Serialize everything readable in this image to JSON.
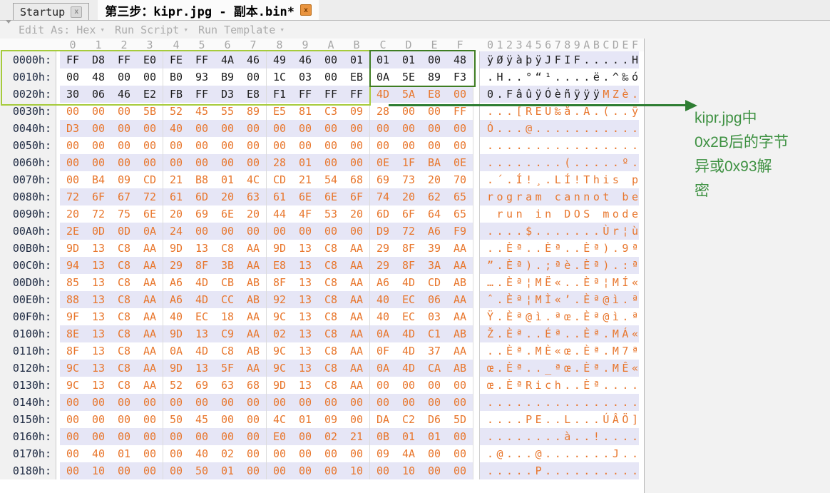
{
  "tabs": {
    "startup": {
      "label": "Startup",
      "close_glyph": "x"
    },
    "active": {
      "label": "第三步：kipr.jpg - 副本.bin*",
      "close_glyph": "x"
    }
  },
  "toolbar": {
    "edit_as": "Edit As: Hex",
    "run_script": "Run Script",
    "run_template": "Run Template",
    "caret": "▾"
  },
  "header": {
    "byte_cols": [
      "0",
      "1",
      "2",
      "3",
      "4",
      "5",
      "6",
      "7",
      "8",
      "9",
      "A",
      "B",
      "C",
      "D",
      "E",
      "F"
    ],
    "ascii_label": "0123456789ABCDEF"
  },
  "rows": [
    {
      "o": "0000h:",
      "b": "FF D8 FF E0 FE FF 4A 46 49 46 00 01 01 01 00 48",
      "k": 16,
      "a": "ÿØÿàþÿJFIF.....H",
      "ak": 16
    },
    {
      "o": "0010h:",
      "b": "00 48 00 00 B0 93 B9 00 1C 03 00 EB 0A 5E 89 F3",
      "k": 16,
      "a": ".H..°“¹....ë.^‰ó",
      "ak": 16
    },
    {
      "o": "0020h:",
      "b": "30 06 46 E2 FB FF D3 E8 F1 FF FF FF 4D 5A E8 00",
      "k": 12,
      "a": "0.FâûÿÓèñÿÿÿMZè.",
      "ak": 12
    },
    {
      "o": "0030h:",
      "b": "00 00 00 5B 52 45 55 89 E5 81 C3 09 28 00 00 FF",
      "k": 0,
      "a": "...[REU‰å.Ã.(..ÿ",
      "ak": 0
    },
    {
      "o": "0040h:",
      "b": "D3 00 00 00 40 00 00 00 00 00 00 00 00 00 00 00",
      "k": 0,
      "a": "Ó...@...........",
      "ak": 0
    },
    {
      "o": "0050h:",
      "b": "00 00 00 00 00 00 00 00 00 00 00 00 00 00 00 00",
      "k": 0,
      "a": "................",
      "ak": 0
    },
    {
      "o": "0060h:",
      "b": "00 00 00 00 00 00 00 00 28 01 00 00 0E 1F BA 0E",
      "k": 0,
      "a": "........(.....º.",
      "ak": 0
    },
    {
      "o": "0070h:",
      "b": "00 B4 09 CD 21 B8 01 4C CD 21 54 68 69 73 20 70",
      "k": 0,
      "a": ".´.Í!¸.LÍ!This p",
      "ak": 0
    },
    {
      "o": "0080h:",
      "b": "72 6F 67 72 61 6D 20 63 61 6E 6E 6F 74 20 62 65",
      "k": 0,
      "a": "rogram cannot be",
      "ak": 0
    },
    {
      "o": "0090h:",
      "b": "20 72 75 6E 20 69 6E 20 44 4F 53 20 6D 6F 64 65",
      "k": 0,
      "a": " run in DOS mode",
      "ak": 0
    },
    {
      "o": "00A0h:",
      "b": "2E 0D 0D 0A 24 00 00 00 00 00 00 00 D9 72 A6 F9",
      "k": 0,
      "a": "....$.......Ùr¦ù",
      "ak": 0
    },
    {
      "o": "00B0h:",
      "b": "9D 13 C8 AA 9D 13 C8 AA 9D 13 C8 AA 29 8F 39 AA",
      "k": 0,
      "a": "..Èª..Èª..Èª).9ª",
      "ak": 0
    },
    {
      "o": "00C0h:",
      "b": "94 13 C8 AA 29 8F 3B AA E8 13 C8 AA 29 8F 3A AA",
      "k": 0,
      "a": "”.Èª).;ªè.Èª).:ª",
      "ak": 0
    },
    {
      "o": "00D0h:",
      "b": "85 13 C8 AA A6 4D CB AB 8F 13 C8 AA A6 4D CD AB",
      "k": 0,
      "a": "….Èª¦MË«..Èª¦MÍ«",
      "ak": 0
    },
    {
      "o": "00E0h:",
      "b": "88 13 C8 AA A6 4D CC AB 92 13 C8 AA 40 EC 06 AA",
      "k": 0,
      "a": "ˆ.Èª¦MÌ«’.Èª@ì.ª",
      "ak": 0
    },
    {
      "o": "00F0h:",
      "b": "9F 13 C8 AA 40 EC 18 AA 9C 13 C8 AA 40 EC 03 AA",
      "k": 0,
      "a": "Ÿ.Èª@ì.ªœ.Èª@ì.ª",
      "ak": 0
    },
    {
      "o": "0100h:",
      "b": "8E 13 C8 AA 9D 13 C9 AA 02 13 C8 AA 0A 4D C1 AB",
      "k": 0,
      "a": "Ž.Èª..Éª..Èª.MÁ«",
      "ak": 0
    },
    {
      "o": "0110h:",
      "b": "8F 13 C8 AA 0A 4D C8 AB 9C 13 C8 AA 0F 4D 37 AA",
      "k": 0,
      "a": "..Èª.MÈ«œ.Èª.M7ª",
      "ak": 0
    },
    {
      "o": "0120h:",
      "b": "9C 13 C8 AA 9D 13 5F AA 9C 13 C8 AA 0A 4D CA AB",
      "k": 0,
      "a": "œ.Èª.._ªœ.Èª.MÊ«",
      "ak": 0
    },
    {
      "o": "0130h:",
      "b": "9C 13 C8 AA 52 69 63 68 9D 13 C8 AA 00 00 00 00",
      "k": 0,
      "a": "œ.ÈªRich..Èª....",
      "ak": 0
    },
    {
      "o": "0140h:",
      "b": "00 00 00 00 00 00 00 00 00 00 00 00 00 00 00 00",
      "k": 0,
      "a": "................",
      "ak": 0
    },
    {
      "o": "0150h:",
      "b": "00 00 00 00 50 45 00 00 4C 01 09 00 DA C2 D6 5D",
      "k": 0,
      "a": "....PE..L...ÚÂÖ]",
      "ak": 0
    },
    {
      "o": "0160h:",
      "b": "00 00 00 00 00 00 00 00 E0 00 02 21 0B 01 01 00",
      "k": 0,
      "a": "........à..!....",
      "ak": 0
    },
    {
      "o": "0170h:",
      "b": "00 40 01 00 00 40 02 00 00 00 00 00 09 4A 00 00",
      "k": 0,
      "a": ".@...@.......J..",
      "ak": 0
    },
    {
      "o": "0180h:",
      "b": "00 10 00 00 00 50 01 00 00 00 00 10 00 10 00 00",
      "k": 0,
      "a": ".....P..........",
      "ak": 0
    }
  ],
  "annotation": {
    "lines": [
      "kipr.jpg中",
      "0x2B后的字节",
      "异或0x93解",
      "密"
    ]
  },
  "colors": {
    "hex_unmodified": "#1b1b1b",
    "hex_modified": "#e8762c",
    "row_stripe": "#e6e6f6",
    "selection_light": "#a6cb3c",
    "selection_dark": "#3f7d23",
    "arrow_green": "#2e7d32",
    "annotation_green": "#3e9142"
  }
}
